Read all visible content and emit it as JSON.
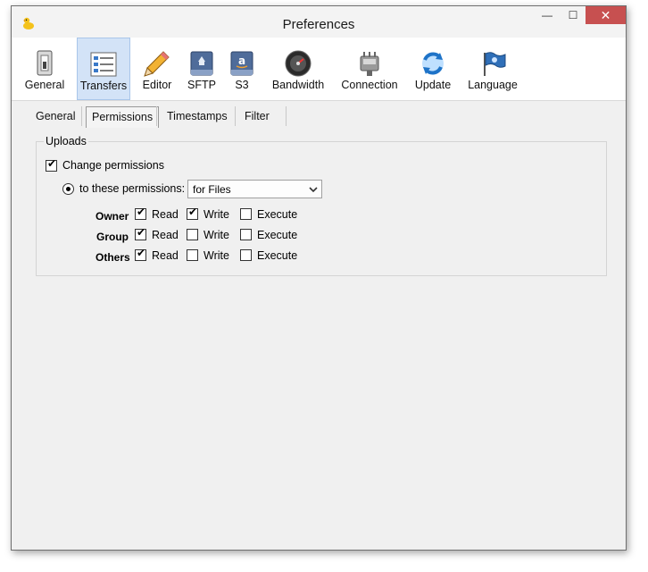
{
  "window": {
    "title": "Preferences",
    "minimize_label": "—",
    "maximize_label": "☐",
    "close_label": "✕"
  },
  "toolbar": {
    "items": [
      {
        "label": "General",
        "icon": "switch-icon"
      },
      {
        "label": "Transfers",
        "icon": "transfers-list-icon",
        "selected": true
      },
      {
        "label": "Editor",
        "icon": "pencil-icon"
      },
      {
        "label": "SFTP",
        "icon": "sftp-drive-icon"
      },
      {
        "label": "S3",
        "icon": "s3-drive-icon"
      },
      {
        "label": "Bandwidth",
        "icon": "speedometer-icon"
      },
      {
        "label": "Connection",
        "icon": "network-plug-icon"
      },
      {
        "label": "Update",
        "icon": "refresh-globe-icon"
      },
      {
        "label": "Language",
        "icon": "flag-icon"
      }
    ]
  },
  "tabs": {
    "items": [
      {
        "label": "General"
      },
      {
        "label": "Permissions",
        "selected": true
      },
      {
        "label": "Timestamps"
      },
      {
        "label": "Filter"
      }
    ]
  },
  "uploads": {
    "title": "Uploads",
    "change_permissions": {
      "label": "Change permissions",
      "checked": true
    },
    "to_these": {
      "label": "to these permissions:",
      "selected": true
    },
    "select_value": "for Files",
    "headers": {
      "read": "Read",
      "write": "Write",
      "execute": "Execute"
    },
    "rows": [
      {
        "label": "Owner",
        "read": true,
        "write": true,
        "execute": false
      },
      {
        "label": "Group",
        "read": true,
        "write": false,
        "execute": false
      },
      {
        "label": "Others",
        "read": true,
        "write": false,
        "execute": false
      }
    ]
  },
  "colors": {
    "selected_tool_bg": "#d3e3f7",
    "close_button": "#c75050"
  }
}
